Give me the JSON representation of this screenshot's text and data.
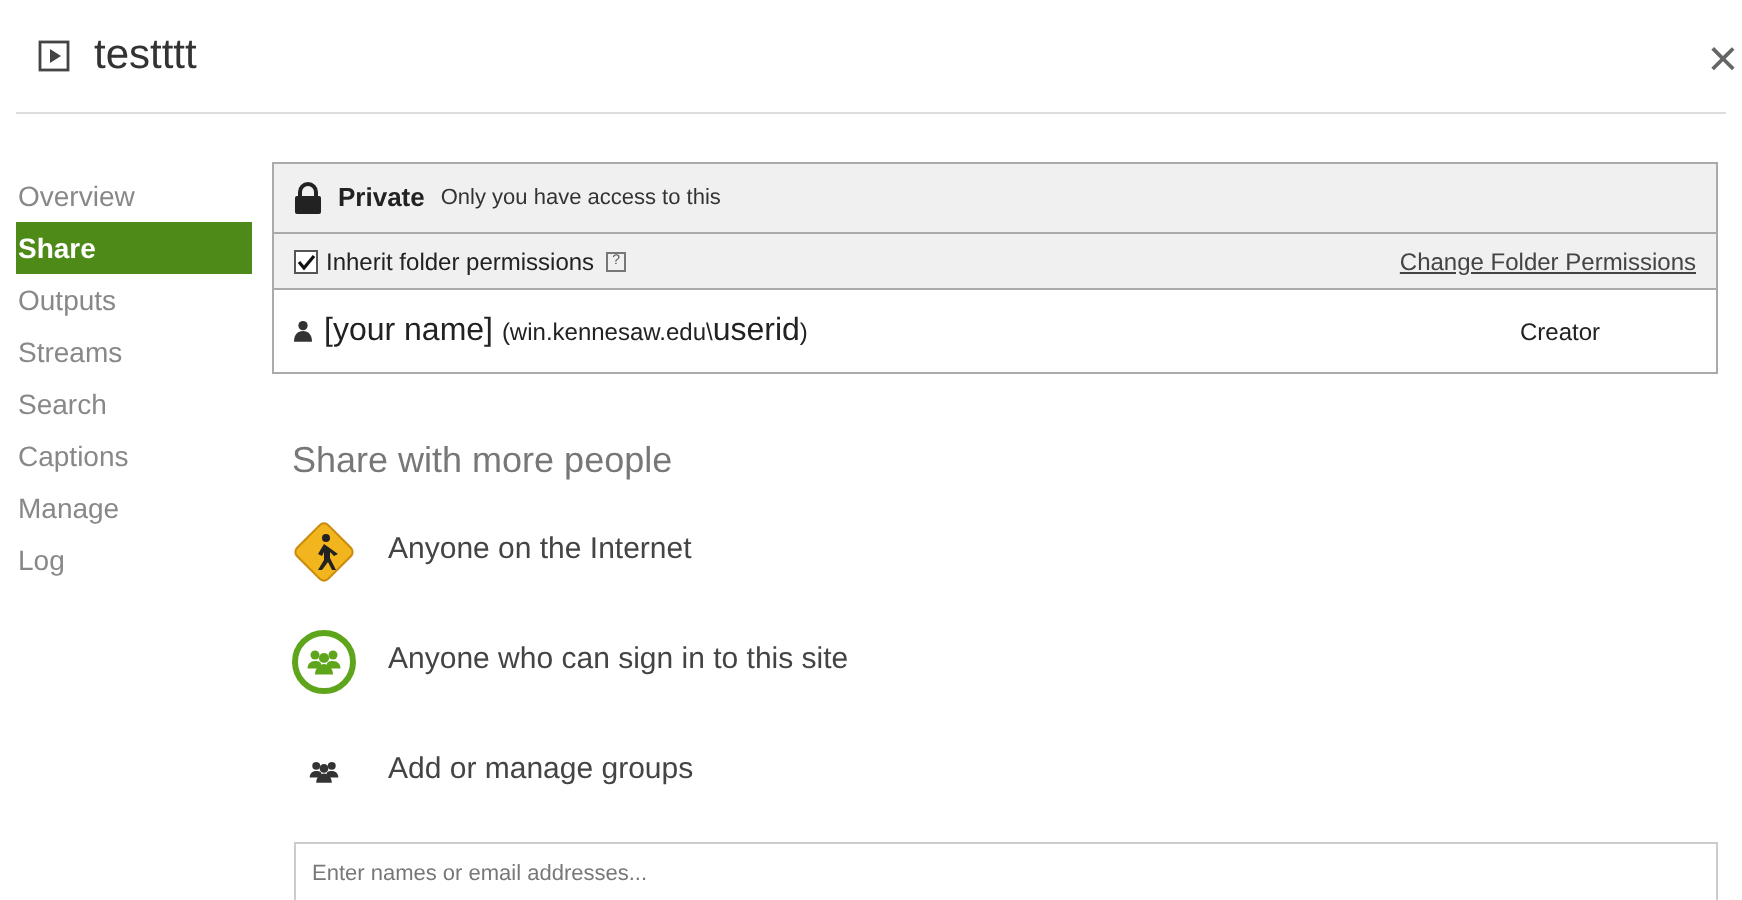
{
  "window": {
    "title": "testttt",
    "close": "×"
  },
  "sidebar": {
    "items": [
      {
        "label": "Overview",
        "selected": false
      },
      {
        "label": "Share",
        "selected": true
      },
      {
        "label": "Outputs",
        "selected": false
      },
      {
        "label": "Streams",
        "selected": false
      },
      {
        "label": "Search",
        "selected": false
      },
      {
        "label": "Captions",
        "selected": false
      },
      {
        "label": "Manage",
        "selected": false
      },
      {
        "label": "Log",
        "selected": false
      }
    ]
  },
  "access": {
    "level": "Private",
    "description": "Only you have access to this"
  },
  "inherit": {
    "label": "Inherit folder permissions",
    "help": "?",
    "checked": true,
    "link": "Change Folder Permissions"
  },
  "owner": {
    "name": "[your name]",
    "account_open": "(win.kennesaw.edu\\",
    "userid": "userid",
    "account_close": ")",
    "role": "Creator"
  },
  "share_more": {
    "title": "Share with more people",
    "options": [
      {
        "kind": "public",
        "label": "Anyone on the Internet"
      },
      {
        "kind": "signed-in",
        "label": "Anyone who can sign in to this site"
      },
      {
        "kind": "groups",
        "label": "Add or manage groups"
      }
    ],
    "field": {
      "placeholder": "Enter names or email addresses..."
    }
  }
}
